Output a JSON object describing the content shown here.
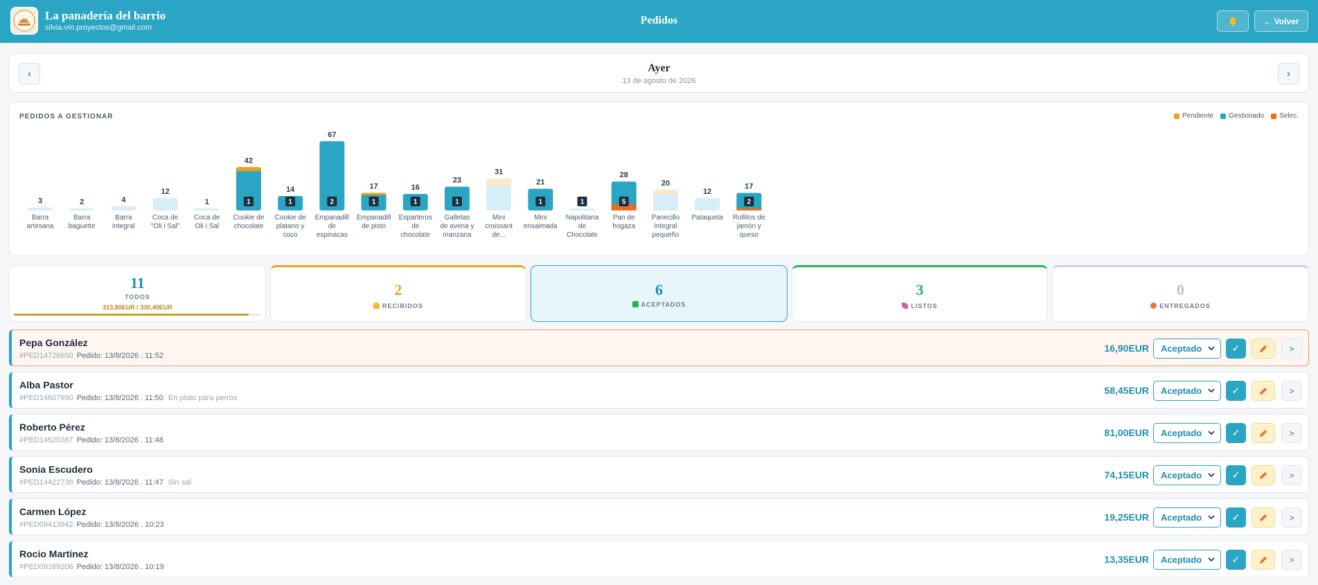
{
  "header": {
    "app_name": "La panadería del barrio",
    "email": "silvia.vm.proyectos@gmail.com",
    "title": "Pedidos",
    "back_label": "← Volver",
    "bell_icon": "bell-icon",
    "logo_icon": "bakery-logo-icon"
  },
  "date_nav": {
    "title": "Ayer",
    "subtitle": "13 de agosto de 2026",
    "prev_label": "‹",
    "next_label": "›"
  },
  "chart_data": {
    "type": "bar",
    "title": "PEDIDOS A GESTIONAR",
    "legend": [
      {
        "name": "Pendiente",
        "color": "#f0a21a"
      },
      {
        "name": "Gestionado",
        "color": "#2aa5c4"
      },
      {
        "name": "Selec.",
        "color": "#ee6a1f"
      }
    ],
    "legend_position": "top-right",
    "grid": false,
    "categories": [
      [
        "Barra",
        "artesana"
      ],
      [
        "Barra",
        "baguette"
      ],
      [
        "Barra",
        "integral"
      ],
      [
        "Coca de",
        "\"Oli i Sal\""
      ],
      [
        "Coca de",
        "Oli i Sal"
      ],
      [
        "Cookie de",
        "chocolate"
      ],
      [
        "Cookie de",
        "platano y",
        "coco"
      ],
      [
        "Empanadill",
        "de",
        "espinacas"
      ],
      [
        "Empanadill",
        "de pisto"
      ],
      [
        "Esparteros",
        "de",
        "chocolate"
      ],
      [
        "Galletas",
        "de avena y",
        "manzana"
      ],
      [
        "Mini",
        "croissant",
        "de..."
      ],
      [
        "Mini",
        "ensaimada"
      ],
      [
        "Napolitana",
        "de",
        "Chocolate"
      ],
      [
        "Pan de",
        "hogaza"
      ],
      [
        "Panecillo",
        "Integral",
        "pequeño"
      ],
      [
        "Pataqueta"
      ],
      [
        "Rollitos de",
        "jamón y",
        "queso"
      ]
    ],
    "totals": [
      3,
      2,
      4,
      12,
      1,
      42,
      14,
      67,
      17,
      16,
      23,
      31,
      21,
      1,
      28,
      20,
      12,
      17
    ],
    "gestionado": [
      0,
      0,
      0,
      0,
      0,
      38,
      14,
      67,
      15,
      16,
      23,
      0,
      21,
      0,
      22,
      0,
      0,
      15
    ],
    "pendiente": [
      0,
      0,
      0,
      0,
      0,
      4,
      0,
      0,
      2,
      0,
      0,
      7,
      0,
      0,
      0,
      4,
      0,
      0
    ],
    "seleccionado": [
      0,
      0,
      0,
      0,
      0,
      0,
      0,
      0,
      0,
      0,
      0,
      0,
      0,
      0,
      6,
      0,
      0,
      2
    ],
    "selected_counts": [
      null,
      null,
      null,
      null,
      null,
      1,
      1,
      2,
      1,
      1,
      1,
      null,
      1,
      1,
      5,
      null,
      null,
      2
    ],
    "ylim": [
      0,
      67
    ]
  },
  "stats": [
    {
      "count": "11",
      "label": "TODOS",
      "color": "#1f8fae",
      "total": "313,80EUR / 330,40EUR",
      "progress": 0.95
    },
    {
      "count": "2",
      "label": "RECIBIDOS",
      "color": "#f0a21a",
      "icon": "bell-icon"
    },
    {
      "count": "6",
      "label": "ACEPTADOS",
      "color": "#1f8fae",
      "icon": "check-icon"
    },
    {
      "count": "3",
      "label": "LISTOS",
      "color": "#22b55a",
      "icon": "party-icon"
    },
    {
      "count": "0",
      "label": "ENTREGADOS",
      "color": "#b8c0c8",
      "icon": "package-icon"
    }
  ],
  "orders": [
    {
      "name": "Pepa González",
      "code": "#PED14726650",
      "date": "Pedido: 13/8/2026 . 11:52",
      "note": "",
      "amount": "16,90EUR",
      "status": "Aceptado"
    },
    {
      "name": "Alba Pastor",
      "code": "#PED14607990",
      "date": "Pedido: 13/8/2026 . 11:50",
      "note": "En plato para perros",
      "amount": "58,45EUR",
      "status": "Aceptado"
    },
    {
      "name": "Roberto Pérez",
      "code": "#PED14520367",
      "date": "Pedido: 13/8/2026 . 11:48",
      "note": "",
      "amount": "81,00EUR",
      "status": "Aceptado"
    },
    {
      "name": "Sonia Escudero",
      "code": "#PED14422738",
      "date": "Pedido: 13/8/2026 . 11:47",
      "note": "Sin sal",
      "amount": "74,15EUR",
      "status": "Aceptado"
    },
    {
      "name": "Carmen López",
      "code": "#PED09413942",
      "date": "Pedido: 13/8/2026 . 10:23",
      "note": "",
      "amount": "19,25EUR",
      "status": "Aceptado"
    },
    {
      "name": "Rocio Martinez",
      "code": "#PED09169206",
      "date": "Pedido: 13/8/2026 . 10:19",
      "note": "",
      "amount": "13,35EUR",
      "status": "Aceptado"
    }
  ],
  "colors": {
    "primary": "#2aa5c4",
    "pending": "#f0a21a",
    "selected": "#ee6a1f",
    "empty_bar": "#d6eef5",
    "empty_pending": "#fde8c8"
  }
}
